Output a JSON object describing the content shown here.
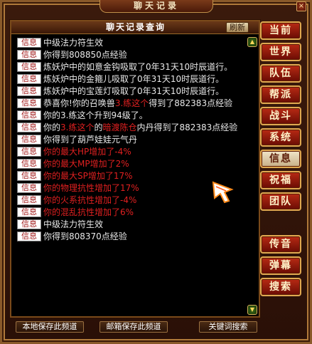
{
  "window": {
    "title": "聊天记录",
    "close_glyph": "×"
  },
  "panel": {
    "title": "聊天记录查询",
    "refresh_label": "刷新",
    "scroll_up": "▲",
    "scroll_down": "▼"
  },
  "entries": [
    {
      "tag": "信息",
      "parts": [
        {
          "text": "中级法力符生效",
          "color": "normal"
        }
      ]
    },
    {
      "tag": "信息",
      "parts": [
        {
          "text": "你得到808850点经验",
          "color": "normal"
        }
      ]
    },
    {
      "tag": "信息",
      "parts": [
        {
          "text": "炼妖炉中的如意金钩吸取了0年31天10时辰道行。",
          "color": "normal"
        }
      ]
    },
    {
      "tag": "信息",
      "parts": [
        {
          "text": "炼妖炉中的金箍儿吸取了0年31天10时辰道行。",
          "color": "normal"
        }
      ]
    },
    {
      "tag": "信息",
      "parts": [
        {
          "text": "炼妖炉中的宝莲灯吸取了0年31天10时辰道行。",
          "color": "normal"
        }
      ]
    },
    {
      "tag": "信息",
      "parts": [
        {
          "text": "恭喜你!你的召唤兽",
          "color": "normal"
        },
        {
          "text": "3.练这个",
          "color": "red"
        },
        {
          "text": "得到了882383点经验",
          "color": "normal"
        }
      ]
    },
    {
      "tag": "信息",
      "parts": [
        {
          "text": "你的3.练这个升到94级了。",
          "color": "normal"
        }
      ]
    },
    {
      "tag": "信息",
      "parts": [
        {
          "text": "你的",
          "color": "normal"
        },
        {
          "text": "3.练这个",
          "color": "red"
        },
        {
          "text": "的",
          "color": "normal"
        },
        {
          "text": "暗渡陈仓",
          "color": "red"
        },
        {
          "text": "内丹得到了882383点经验",
          "color": "normal"
        }
      ]
    },
    {
      "tag": "信息",
      "parts": [
        {
          "text": "你得到了葫芦娃娃元气丹",
          "color": "normal"
        }
      ]
    },
    {
      "tag": "信息",
      "parts": [
        {
          "text": "你的最大HP增加了-4%",
          "color": "red"
        }
      ]
    },
    {
      "tag": "信息",
      "parts": [
        {
          "text": "你的最大MP增加了2%",
          "color": "red"
        }
      ]
    },
    {
      "tag": "信息",
      "parts": [
        {
          "text": "你的最大SP增加了17%",
          "color": "red"
        }
      ]
    },
    {
      "tag": "信息",
      "parts": [
        {
          "text": "你的物理抗性增加了17%",
          "color": "red"
        }
      ]
    },
    {
      "tag": "信息",
      "parts": [
        {
          "text": "你的火系抗性增加了-4%",
          "color": "red"
        }
      ]
    },
    {
      "tag": "信息",
      "parts": [
        {
          "text": "你的混乱抗性增加了6%",
          "color": "red"
        }
      ]
    },
    {
      "tag": "信息",
      "parts": [
        {
          "text": "中级法力符生效",
          "color": "normal"
        }
      ]
    },
    {
      "tag": "信息",
      "parts": [
        {
          "text": "你得到808370点经验",
          "color": "normal"
        }
      ]
    }
  ],
  "side_buttons": [
    {
      "label": "当前",
      "active": false
    },
    {
      "label": "世界",
      "active": false
    },
    {
      "label": "队伍",
      "active": false
    },
    {
      "label": "帮派",
      "active": false
    },
    {
      "label": "战斗",
      "active": false
    },
    {
      "label": "系统",
      "active": false
    },
    {
      "label": "信息",
      "active": true
    },
    {
      "label": "祝福",
      "active": false
    },
    {
      "label": "团队",
      "active": false
    },
    {
      "label": "传音",
      "active": false
    },
    {
      "label": "弹幕",
      "active": false
    },
    {
      "label": "搜索",
      "active": false
    }
  ],
  "bottom_buttons": {
    "save_local": "本地保存此频道",
    "mail_save": "邮箱保存此频道",
    "keyword_search": "关键词搜索"
  },
  "colors": {
    "red_text": "#e02020",
    "normal_text": "#e8e8e8",
    "tag_text": "#a01818"
  }
}
